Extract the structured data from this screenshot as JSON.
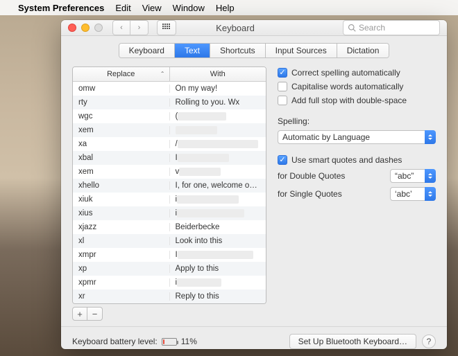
{
  "menubar": {
    "app": "System Preferences",
    "items": [
      "Edit",
      "View",
      "Window",
      "Help"
    ]
  },
  "window": {
    "title": "Keyboard",
    "search_placeholder": "Search"
  },
  "tabs": [
    "Keyboard",
    "Text",
    "Shortcuts",
    "Input Sources",
    "Dictation"
  ],
  "active_tab": "Text",
  "columns": {
    "replace": "Replace",
    "with": "With"
  },
  "rows": [
    {
      "replace": "omw",
      "with": "On my way!",
      "blur": false
    },
    {
      "replace": "rty",
      "with": "Rolling to you. Wx",
      "blur": false
    },
    {
      "replace": "wgc",
      "with": "(",
      "blur": true
    },
    {
      "replace": "xem",
      "with": "",
      "blur": true
    },
    {
      "replace": "xa",
      "with": "/",
      "blur": true
    },
    {
      "replace": "xbal",
      "with": "I",
      "blur": true
    },
    {
      "replace": "xem",
      "with": "v",
      "blur": true
    },
    {
      "replace": "xhello",
      "with": "I, for one, welcome our ne...",
      "blur": false
    },
    {
      "replace": "xiuk",
      "with": "i",
      "blur": true
    },
    {
      "replace": "xius",
      "with": "i",
      "blur": true
    },
    {
      "replace": "xjazz",
      "with": "Beiderbecke",
      "blur": false
    },
    {
      "replace": "xl",
      "with": "Look into this",
      "blur": false
    },
    {
      "replace": "xmpr",
      "with": "I",
      "blur": true
    },
    {
      "replace": "xp",
      "with": "Apply to this",
      "blur": false
    },
    {
      "replace": "xpmr",
      "with": "i",
      "blur": true
    },
    {
      "replace": "xr",
      "with": "Reply to this",
      "blur": false
    }
  ],
  "options": {
    "correct_spelling": {
      "label": "Correct spelling automatically",
      "checked": true
    },
    "capitalise_words": {
      "label": "Capitalise words automatically",
      "checked": false
    },
    "full_stop": {
      "label": "Add full stop with double-space",
      "checked": false
    },
    "spelling_label": "Spelling:",
    "spelling_value": "Automatic by Language",
    "smart_quotes": {
      "label": "Use smart quotes and dashes",
      "checked": true
    },
    "double_quotes_label": "for Double Quotes",
    "double_quotes_value": "“abc”",
    "single_quotes_label": "for Single Quotes",
    "single_quotes_value": "‘abc’"
  },
  "footer": {
    "battery_label": "Keyboard battery level:",
    "battery_pct": "11%",
    "bluetooth_btn": "Set Up Bluetooth Keyboard…"
  }
}
